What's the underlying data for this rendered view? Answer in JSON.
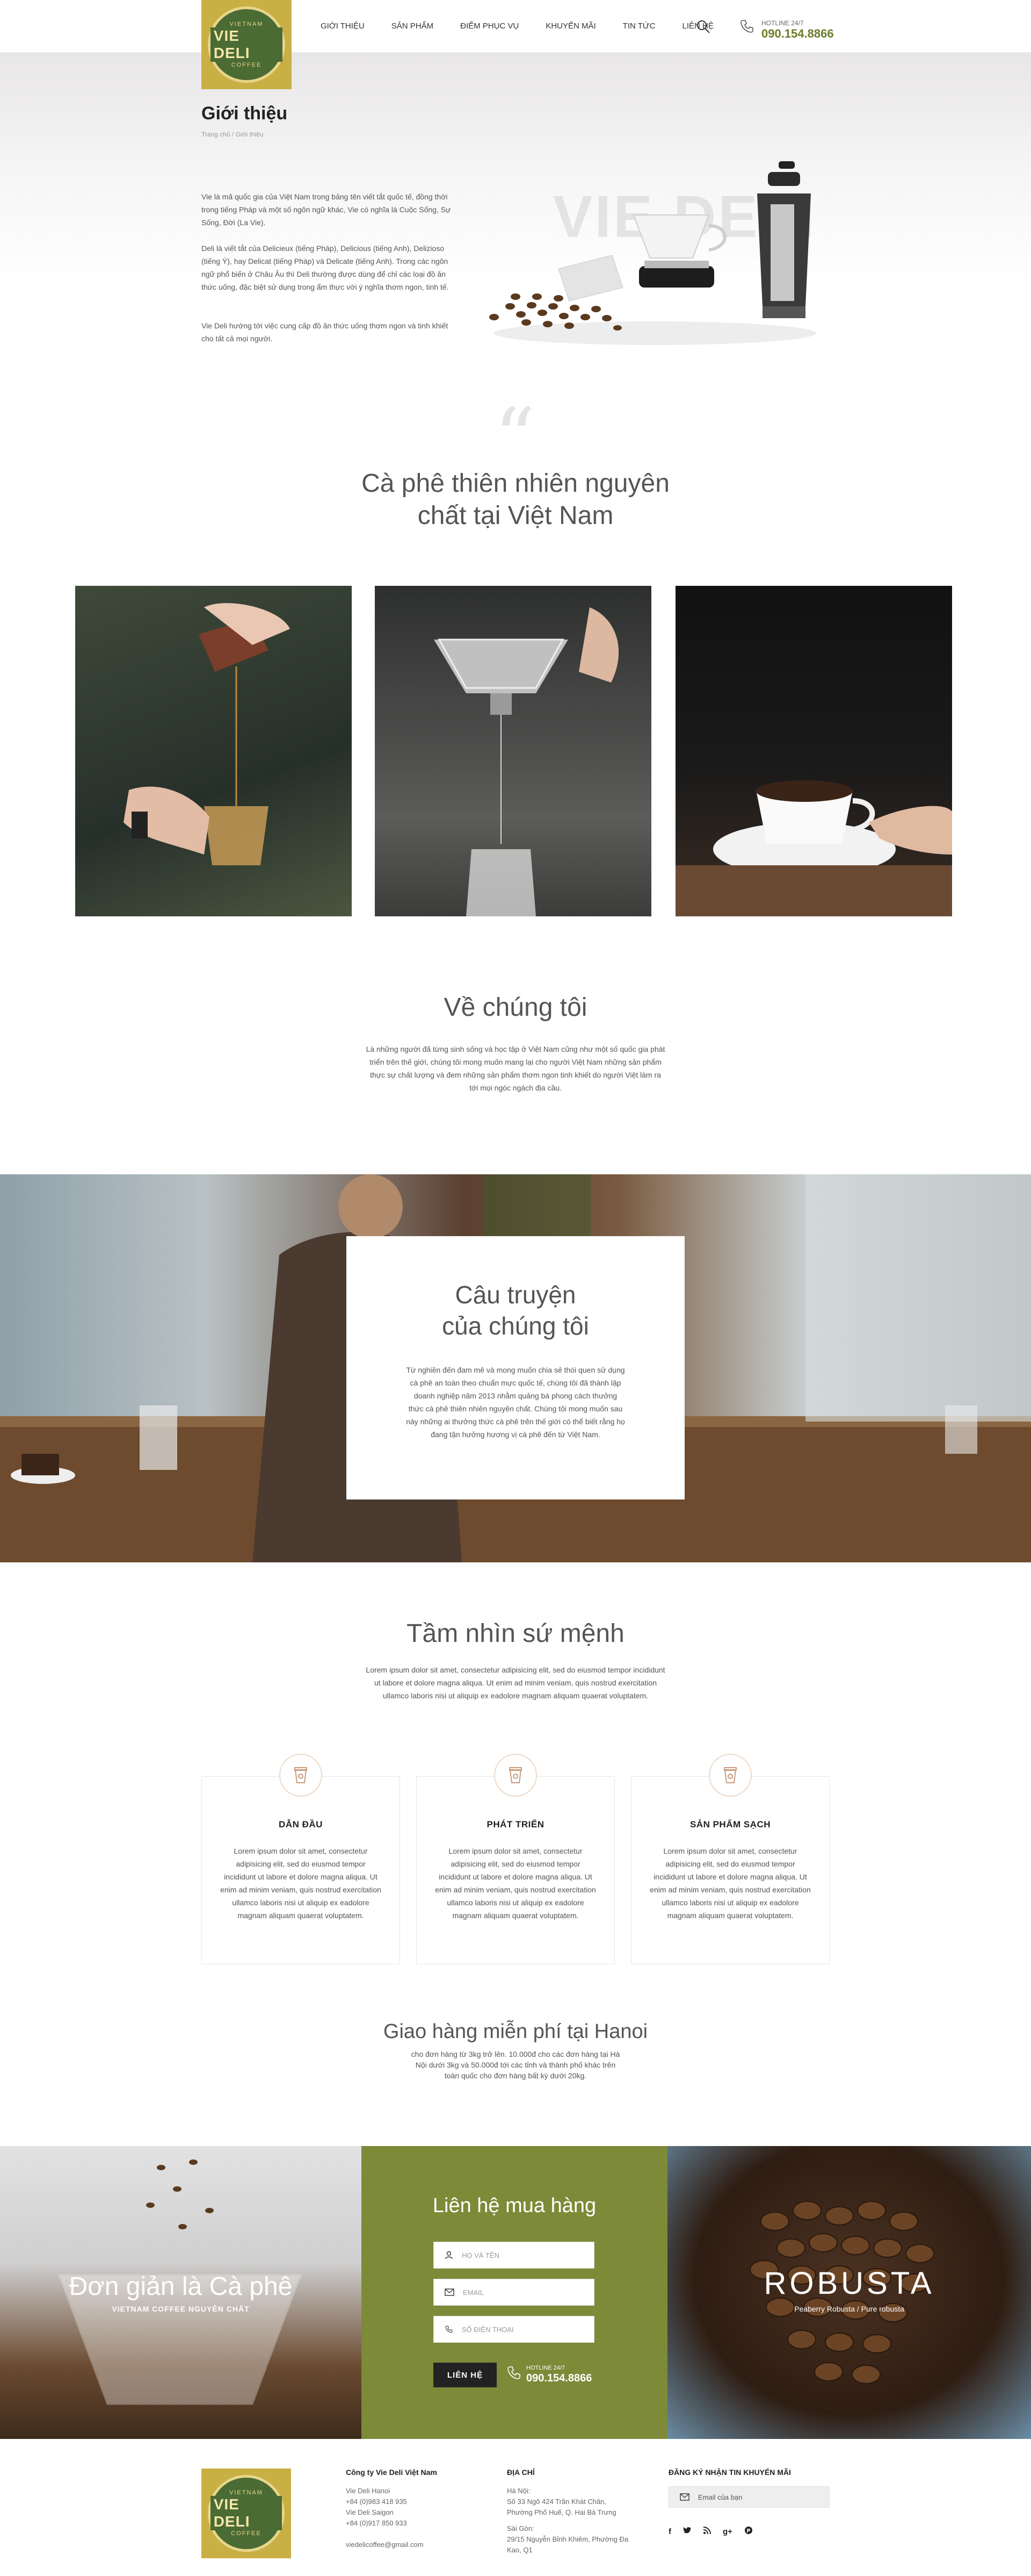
{
  "brand": {
    "logo_top": "VIETNAM",
    "logo_text": "VIE DELI",
    "logo_bottom": "COFFEE"
  },
  "nav": {
    "items": [
      "GIỚI THIỆU",
      "SẢN PHẨM",
      "ĐIỂM PHỤC VỤ",
      "KHUYẾN MÃI",
      "TIN TỨC",
      "LIÊN HỆ"
    ]
  },
  "hotline": {
    "label": "HOTLINE 24/7",
    "number": "090.154.8866"
  },
  "hero": {
    "title": "Giới thiệu",
    "breadcrumb": "Trang chủ / Giới thiệu",
    "watermark": "VIE DELI",
    "para1": "Vie là mã quốc gia của Việt Nam trong bảng tên viết tắt quốc tế, đồng thời trong tiếng Pháp và một số ngôn ngữ khác, Vie có nghĩa là Cuộc Sống, Sự Sống, Đời (La Vie).",
    "para2": "Deli là viết tắt của Delicieux (tiếng Pháp), Delicious (tiếng Anh), Delizioso (tiếng Ý), hay Delicat (tiếng Pháp) và Delicate (tiếng Anh). Trong các ngôn ngữ phổ biến ở Châu Âu thì Deli thường được dùng để chỉ các loại đồ ăn thức uống, đặc biệt sử dụng trong ẩm thực với ý nghĩa thơm ngon, tinh tế.",
    "para3": "Vie Deli hướng tới việc cung cấp đồ ăn thức uống thơm ngon và tinh khiết cho tất cả mọi người."
  },
  "quote_section": {
    "mark": "“",
    "title_line1": "Cà phê thiên nhiên nguyên",
    "title_line2": "chất tại Việt Nam"
  },
  "about": {
    "title": "Về chúng tôi",
    "text": "Là những người đã từng sinh sống và học tập ở Việt Nam cũng như một số quốc gia phát triển trên thế giới, chúng tôi mong muốn mang lại cho người Việt Nam những sản phẩm thực sự chất lượng và đem những sản phẩm thơm ngon tinh khiết do người Việt làm ra tới mọi ngóc ngách địa cầu."
  },
  "story": {
    "title_line1": "Câu truyện",
    "title_line2": "của chúng tôi",
    "text": "Từ nghiền đến đam mê và mong muốn chia sẻ thói quen sử dụng cà phê an toàn theo chuẩn mực quốc tế, chúng tôi đã thành lập doanh nghiệp năm 2013 nhằm quảng bá phong cách thưởng thức cà phê thiên nhiên nguyên chất. Chúng tôi mong muốn sau này những ai thưởng thức cà phê trên thế giới có thể biết rằng họ đang tận hưởng hương vị cà phê đến từ Việt Nam."
  },
  "vision": {
    "title": "Tầm nhìn sứ mệnh",
    "text": "Lorem ipsum dolor sit amet, consectetur adipisicing elit, sed do eiusmod tempor incididunt ut labore et dolore magna aliqua. Ut enim ad minim veniam, quis nostrud exercitation ullamco laboris nisi ut aliquip ex eadolore magnam aliquam quaerat voluptatem.",
    "cards": [
      {
        "title": "DẪN ĐẦU",
        "text": "Lorem ipsum dolor sit amet, consectetur adipisicing elit, sed do eiusmod tempor incididunt ut labore et dolore magna aliqua. Ut enim ad minim veniam, quis nostrud exercitation ullamco laboris nisi ut aliquip ex eadolore magnam aliquam quaerat voluptatem."
      },
      {
        "title": "PHÁT TRIỂN",
        "text": "Lorem ipsum dolor sit amet, consectetur adipisicing elit, sed do eiusmod tempor incididunt ut labore et dolore magna aliqua. Ut enim ad minim veniam, quis nostrud exercitation ullamco laboris nisi ut aliquip ex eadolore magnam aliquam quaerat voluptatem."
      },
      {
        "title": "SẢN PHẨM SẠCH",
        "text": "Lorem ipsum dolor sit amet, consectetur adipisicing elit, sed do eiusmod tempor incididunt ut labore et dolore magna aliqua. Ut enim ad minim veniam, quis nostrud exercitation ullamco laboris nisi ut aliquip ex eadolore magnam aliquam quaerat voluptatem."
      }
    ]
  },
  "delivery": {
    "title": "Giao hàng miễn phí tại Hanoi",
    "text": "cho đơn hàng từ 3kg trở lên. 10.000đ cho các đơn hàng tại Hà Nội dưới 3kg và 50.000đ tới các tỉnh và thành phố khác trên toàn quốc cho đơn hàng bất kỳ dưới 20kg."
  },
  "promo": {
    "left_title": "Đơn giản là Cà phê",
    "left_sub": "VIETNAM COFFEE NGUYÊN CHẤT",
    "right_title": "ROBUSTA",
    "right_sub": "Peaberry Robusta / Pure robusta"
  },
  "contact": {
    "title": "Liên hệ mua hàng",
    "name_placeholder": "HỌ VÀ TÊN",
    "email_placeholder": "EMAIL",
    "phone_placeholder": "SỐ ĐIỆN THOẠI",
    "button": "LIÊN HỆ",
    "hotline_label": "HOTLINE 24/7",
    "hotline_number": "090.154.8866"
  },
  "footer": {
    "company": {
      "title": "Công ty Vie Deli Việt Nam",
      "lines": [
        "Vie Deli Hanoi",
        "+84 (0)983 418 935",
        "Vie Deli Saigon",
        "+84 (0)917 850 933",
        "",
        "viedelicoffee@gmail.com"
      ]
    },
    "address": {
      "title": "ĐỊA CHỈ",
      "hanoi_label": "Hà Nội:",
      "hanoi": "Số 33 Ngõ 424 Trần Khát Chân, Phường Phố Huế, Q. Hai Bà Trưng",
      "saigon_label": "Sài Gòn:",
      "saigon": "29/15 Nguyễn Bỉnh Khiêm, Phường Đa Kao, Q1"
    },
    "newsletter": {
      "title": "ĐĂNG KÝ NHẬN TIN KHUYẾN MÃI",
      "placeholder": "Email của bạn"
    },
    "social": [
      "f",
      "t",
      "rss",
      "g+",
      "p"
    ]
  },
  "colors": {
    "olive": "#7d8a38",
    "gold": "#c9b045",
    "accent_text": "#6b7d2c"
  }
}
